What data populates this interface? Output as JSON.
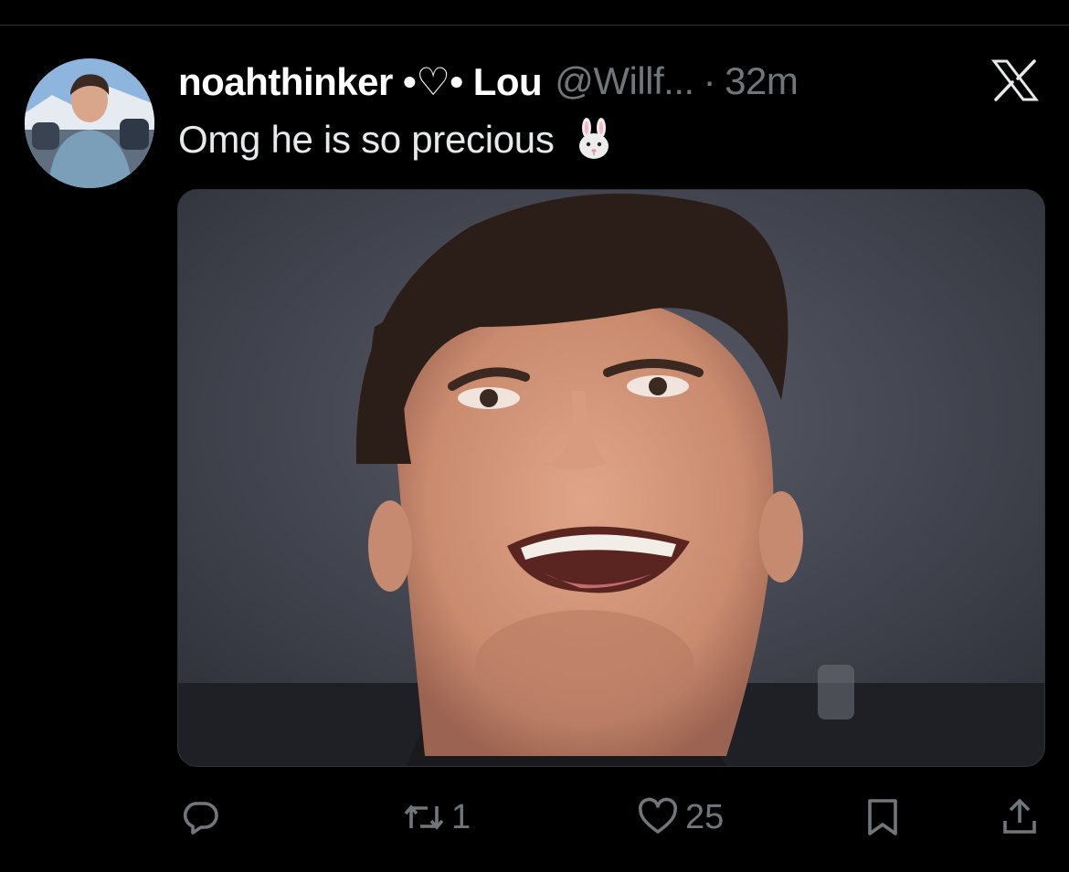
{
  "tweet": {
    "display_name": "noahthinker •♡• Lou",
    "handle": "@Willf...",
    "separator": "·",
    "time": "32m",
    "text": "Omg he is so precious",
    "emoji": "rabbit-face",
    "avatar": "avatar",
    "media": "photo"
  },
  "actions": {
    "reply": {
      "icon": "reply-icon"
    },
    "retweet": {
      "icon": "retweet-icon",
      "count": "1"
    },
    "like": {
      "icon": "heart-icon",
      "count": "25"
    },
    "bookmark": {
      "icon": "bookmark-icon"
    },
    "share": {
      "icon": "share-icon"
    }
  },
  "header": {
    "logo": "x-logo-icon"
  },
  "colors": {
    "background": "#000000",
    "text": "#e7e9ea",
    "muted": "#71767b",
    "divider": "#2f3336"
  }
}
